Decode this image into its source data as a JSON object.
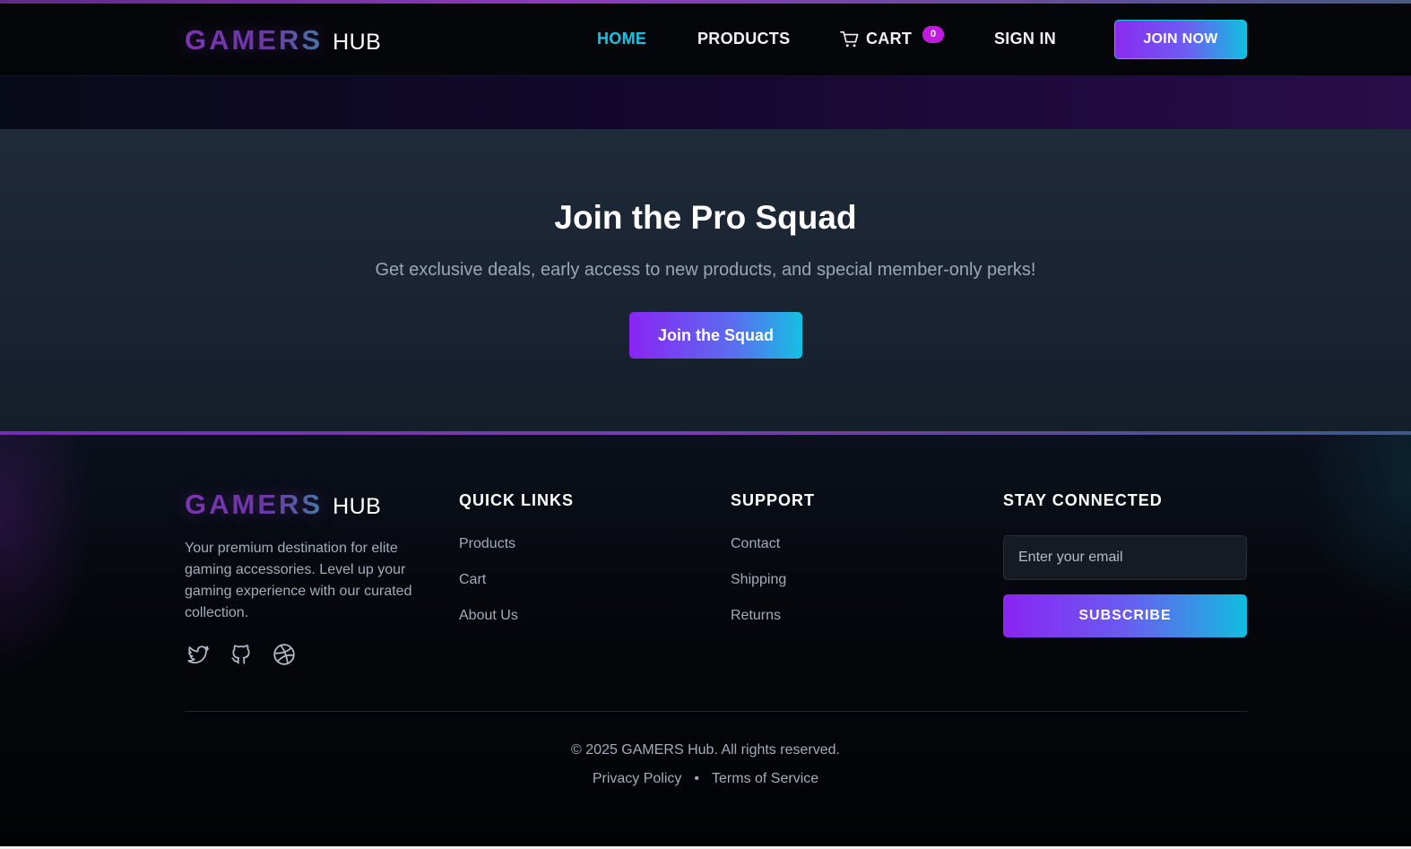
{
  "colors": {
    "accent_purple": "#8a24f3",
    "accent_cyan": "#10c0e0",
    "active_nav": "#16c4e8",
    "badge": "#c21be0"
  },
  "brand": {
    "name_part1": "GAMERS",
    "name_part2": "HUB"
  },
  "nav": {
    "home": "HOME",
    "products": "PRODUCTS",
    "cart": "CART",
    "cart_count": "0",
    "sign_in": "SIGN IN",
    "join_now": "JOIN NOW",
    "icons": {
      "cart": "cart-icon"
    }
  },
  "cta": {
    "title": "Join the Pro Squad",
    "subtitle": "Get exclusive deals, early access to new products, and special member-only perks!",
    "button": "Join the Squad"
  },
  "footer": {
    "description": "Your premium destination for elite gaming accessories. Level up your gaming experience with our curated collection.",
    "social_icons": [
      "twitter-icon",
      "github-icon",
      "dribbble-icon"
    ],
    "quick_links": {
      "title": "QUICK LINKS",
      "items": [
        "Products",
        "Cart",
        "About Us"
      ]
    },
    "support": {
      "title": "SUPPORT",
      "items": [
        "Contact",
        "Shipping",
        "Returns"
      ]
    },
    "stay_connected": {
      "title": "STAY CONNECTED",
      "email_placeholder": "Enter your email",
      "subscribe": "SUBSCRIBE"
    },
    "copyright": "© 2025 GAMERS Hub. All rights reserved.",
    "legal": {
      "privacy": "Privacy Policy",
      "separator": "•",
      "terms": "Terms of Service"
    }
  }
}
